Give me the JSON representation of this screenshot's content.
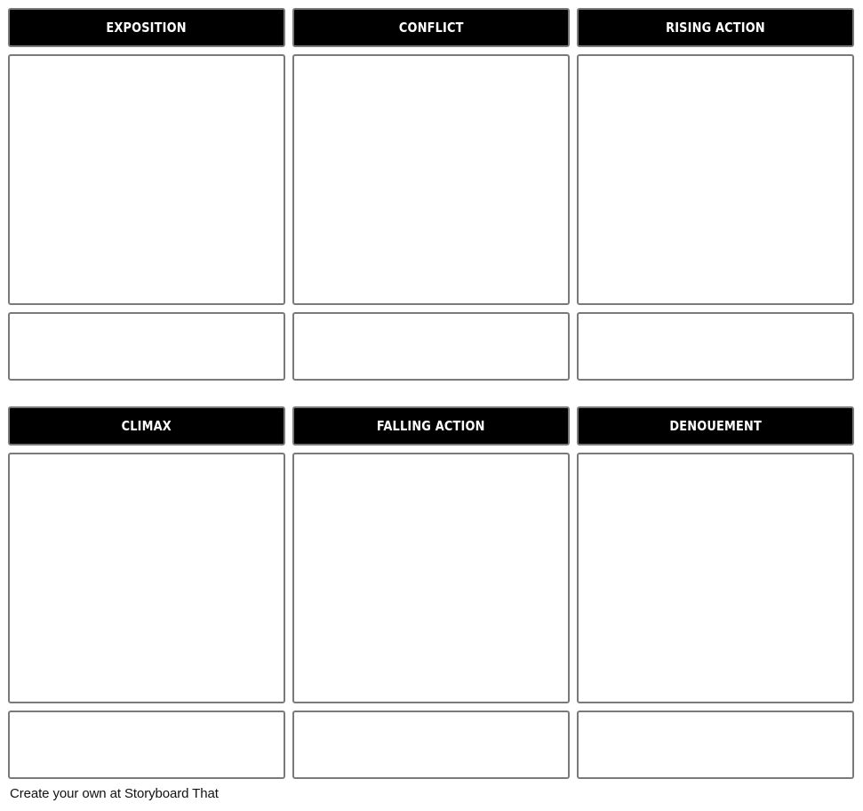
{
  "storyboard": {
    "rows": [
      {
        "cells": [
          {
            "title": "EXPOSITION",
            "image": "",
            "description": ""
          },
          {
            "title": "CONFLICT",
            "image": "",
            "description": ""
          },
          {
            "title": "RISING ACTION",
            "image": "",
            "description": ""
          }
        ]
      },
      {
        "cells": [
          {
            "title": "CLIMAX",
            "image": "",
            "description": ""
          },
          {
            "title": "FALLING ACTION",
            "image": "",
            "description": ""
          },
          {
            "title": "DENOUEMENT",
            "image": "",
            "description": ""
          }
        ]
      }
    ]
  },
  "footer": {
    "text": "Create your own at Storyboard That"
  }
}
